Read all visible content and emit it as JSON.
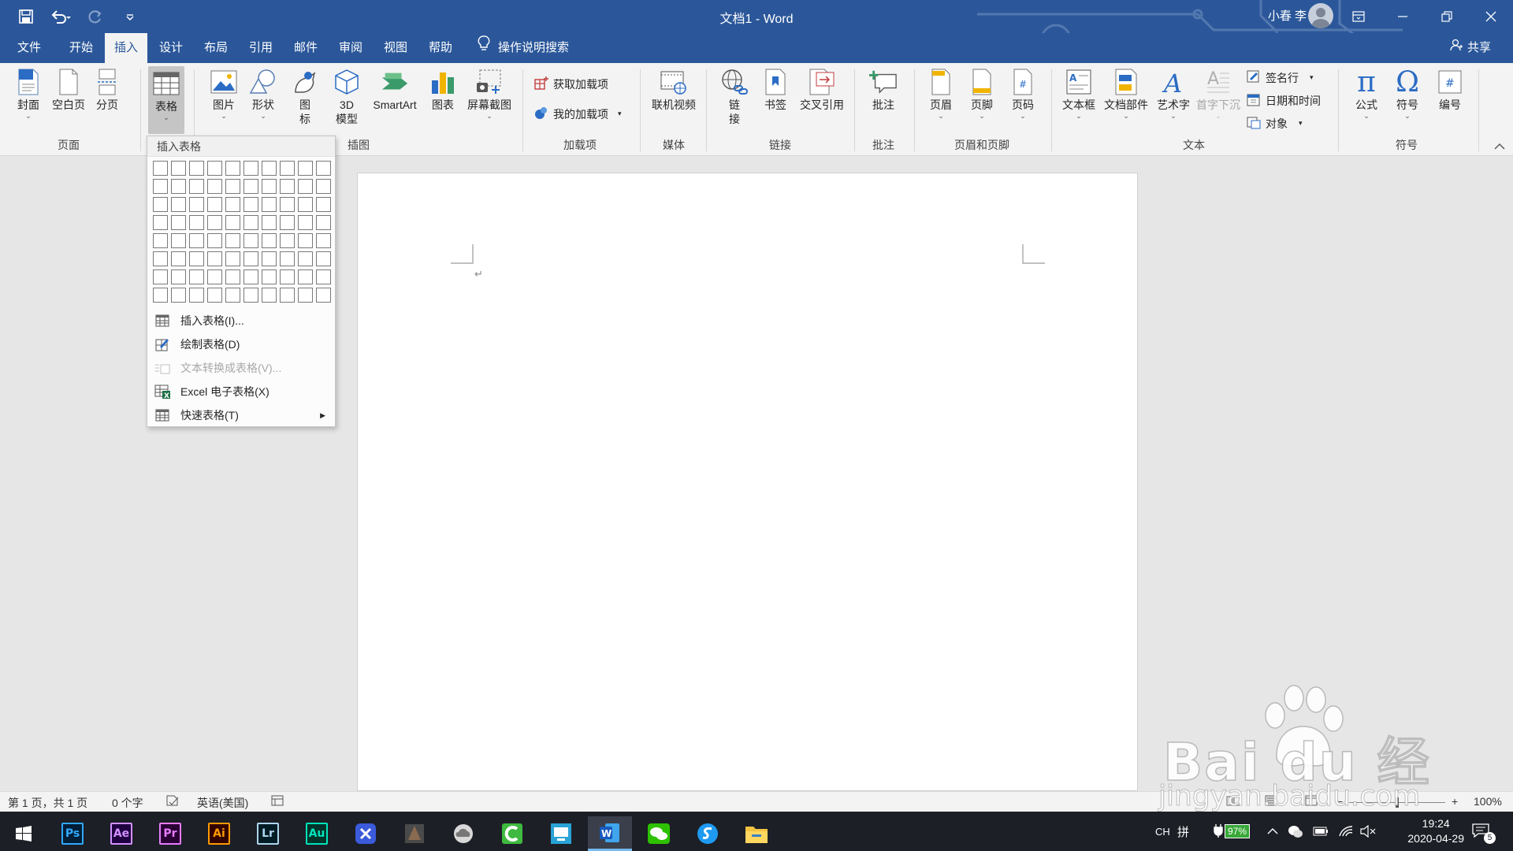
{
  "titlebar": {
    "title": "文档1  -  Word",
    "user": "小春 李"
  },
  "tabs": [
    {
      "label": "文件"
    },
    {
      "label": "开始"
    },
    {
      "label": "插入"
    },
    {
      "label": "设计"
    },
    {
      "label": "布局"
    },
    {
      "label": "引用"
    },
    {
      "label": "邮件"
    },
    {
      "label": "审阅"
    },
    {
      "label": "视图"
    },
    {
      "label": "帮助"
    }
  ],
  "active_tab": "插入",
  "search_label": "操作说明搜索",
  "share_label": "共享",
  "ribbon": {
    "pages": {
      "cover": "封面",
      "blank": "空白页",
      "break": "分页",
      "group": "页面"
    },
    "table": {
      "label": "表格"
    },
    "illustrations": {
      "picture": "图片",
      "shapes": "形状",
      "icons_l1": "图",
      "icons_l2": "标",
      "model_l1": "3D",
      "model_l2": "模型",
      "smartart": "SmartArt",
      "chart": "图表",
      "screenshot": "屏幕截图",
      "group": "插图"
    },
    "addins": {
      "get": "获取加载项",
      "mine": "我的加载项",
      "group": "加载项"
    },
    "media": {
      "video": "联机视频",
      "group": "媒体"
    },
    "links": {
      "link_l1": "链",
      "link_l2": "接",
      "bookmark": "书签",
      "xref": "交叉引用",
      "group": "链接"
    },
    "comments": {
      "comment": "批注",
      "group": "批注"
    },
    "headerfooter": {
      "header": "页眉",
      "footer": "页脚",
      "pagenum": "页码",
      "group": "页眉和页脚"
    },
    "text": {
      "textbox": "文本框",
      "parts": "文档部件",
      "wordart": "艺术字",
      "dropcap": "首字下沉",
      "signature": "签名行",
      "datetime": "日期和时间",
      "object": "对象",
      "group": "文本"
    },
    "symbols": {
      "equation": "公式",
      "symbol": "符号",
      "number": "编号",
      "group": "符号"
    }
  },
  "dropdown": {
    "header": "插入表格",
    "rows": 8,
    "cols": 10,
    "items": [
      {
        "label": "插入表格(I)...",
        "enabled": true
      },
      {
        "label": "绘制表格(D)",
        "enabled": true
      },
      {
        "label": "文本转换成表格(V)...",
        "enabled": false
      },
      {
        "label": "Excel 电子表格(X)",
        "enabled": true
      },
      {
        "label": "快速表格(T)",
        "enabled": true
      }
    ]
  },
  "statusbar": {
    "page": "第 1 页，共 1 页",
    "words": "0 个字",
    "lang": "英语(美国)",
    "zoom": "100%"
  },
  "taskbar": {
    "apps": [
      "Ps",
      "Ae",
      "Pr",
      "Ai",
      "Lr",
      "Au"
    ],
    "ime": "CH",
    "ime2": "拼",
    "battery": "97%",
    "time": "19:24",
    "date": "2020-04-29",
    "notifications": "5"
  },
  "watermark": {
    "big": "Bai du 经验",
    "small": "jingyan.baidu.com"
  },
  "colors": {
    "word_blue": "#2b579a",
    "ribbon_bg": "#f3f3f3",
    "taskbar": "#1c1f26"
  }
}
